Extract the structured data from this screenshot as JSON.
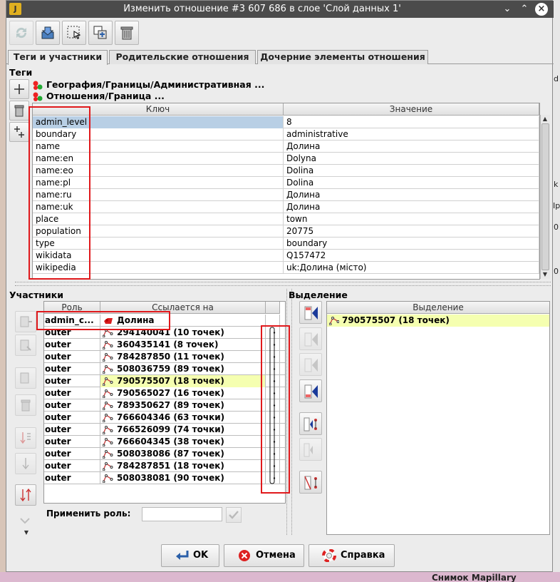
{
  "window": {
    "title": "Изменить отношение #3 607 686 в слое 'Слой данных 1'",
    "controls": {
      "minimize": "⌄",
      "maximize": "⌃",
      "close": "×"
    }
  },
  "toolbar": {
    "buttons": [
      "refresh-icon",
      "apply-to-layer-icon",
      "select-members-icon",
      "duplicate-relation-icon",
      "delete-relation-icon"
    ]
  },
  "tabs": [
    {
      "label": "Теги и участники",
      "active": true
    },
    {
      "label": "Родительские отношения",
      "active": false
    },
    {
      "label": "Дочерние элементы отношения",
      "active": false
    }
  ],
  "tags": {
    "section_label": "Теги",
    "presets": [
      "География/Границы/Административная ...",
      "Отношения/Граница ..."
    ],
    "headers": {
      "key": "Ключ",
      "value": "Значение"
    },
    "rows": [
      {
        "key": "admin_level",
        "value": "8"
      },
      {
        "key": "boundary",
        "value": "administrative"
      },
      {
        "key": "name",
        "value": "Долина"
      },
      {
        "key": "name:en",
        "value": "Dolyna"
      },
      {
        "key": "name:eo",
        "value": "Dolina"
      },
      {
        "key": "name:pl",
        "value": "Dolina"
      },
      {
        "key": "name:ru",
        "value": "Долина"
      },
      {
        "key": "name:uk",
        "value": "Долина"
      },
      {
        "key": "place",
        "value": "town"
      },
      {
        "key": "population",
        "value": "20775"
      },
      {
        "key": "type",
        "value": "boundary"
      },
      {
        "key": "wikidata",
        "value": "Q157472"
      },
      {
        "key": "wikipedia",
        "value": "uk:Долина (місто)"
      }
    ]
  },
  "members": {
    "section_label": "Участники",
    "headers": {
      "role": "Роль",
      "ref": "Ссылается на"
    },
    "rows": [
      {
        "role": "admin_c...",
        "ref": "Долина",
        "kind": "node",
        "highlighted": false
      },
      {
        "role": "outer",
        "ref": "294140041 (10 точек)",
        "kind": "way",
        "highlighted": false
      },
      {
        "role": "outer",
        "ref": "360435141 (8 точек)",
        "kind": "way",
        "highlighted": false
      },
      {
        "role": "outer",
        "ref": "784287850 (11 точек)",
        "kind": "way",
        "highlighted": false
      },
      {
        "role": "outer",
        "ref": "508036759 (89 точек)",
        "kind": "way",
        "highlighted": false
      },
      {
        "role": "outer",
        "ref": "790575507 (18 точек)",
        "kind": "way",
        "highlighted": true
      },
      {
        "role": "outer",
        "ref": "790565027 (16 точек)",
        "kind": "way",
        "highlighted": false
      },
      {
        "role": "outer",
        "ref": "789350627 (89 точек)",
        "kind": "way",
        "highlighted": false
      },
      {
        "role": "outer",
        "ref": "766604346 (63 точки)",
        "kind": "way",
        "highlighted": false
      },
      {
        "role": "outer",
        "ref": "766526099 (74 точки)",
        "kind": "way",
        "highlighted": false
      },
      {
        "role": "outer",
        "ref": "766604345 (38 точек)",
        "kind": "way",
        "highlighted": false
      },
      {
        "role": "outer",
        "ref": "508038086 (87 точек)",
        "kind": "way",
        "highlighted": false
      },
      {
        "role": "outer",
        "ref": "784287851 (18 точек)",
        "kind": "way",
        "highlighted": false
      },
      {
        "role": "outer",
        "ref": "508038081 (90 точек)",
        "kind": "way",
        "highlighted": false
      }
    ],
    "apply_role_label": "Применить роль:",
    "apply_role_value": ""
  },
  "selection": {
    "section_label": "Выделение",
    "header": "Выделение",
    "rows": [
      {
        "ref": "790575507 (18 точек)",
        "kind": "way"
      }
    ]
  },
  "buttons": {
    "ok": "OK",
    "cancel": "Отмена",
    "help": "Справка"
  },
  "background": {
    "right_fragments": [
      "d",
      "Ip",
      "0",
      "k",
      "0"
    ],
    "bottom_fragment": "Снимок Mapillary"
  },
  "colors": {
    "highlight": "#f5ffb0",
    "selected_key": "#b8cfe5",
    "annotation_red": "#e0191c",
    "titlebar": "#4b4b4b"
  }
}
